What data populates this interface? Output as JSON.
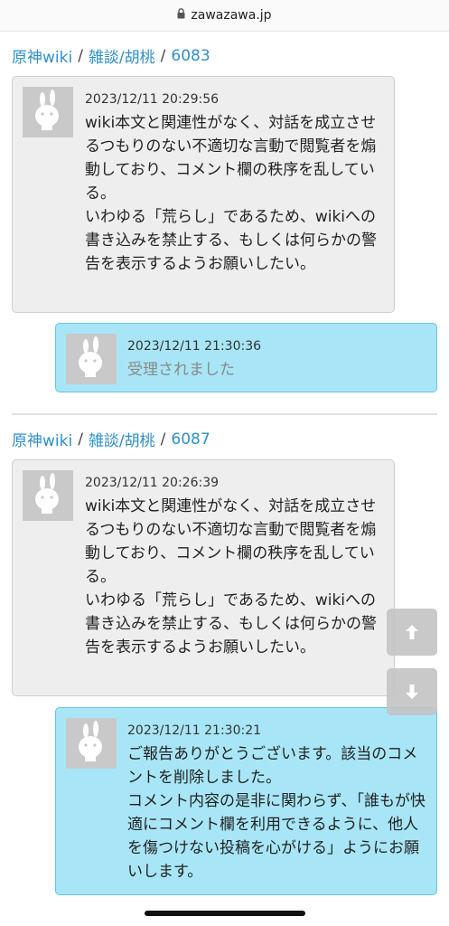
{
  "url": "zawazawa.jp",
  "sections": [
    {
      "crumb": {
        "site": "原神wiki",
        "topic": "雑談/胡桃",
        "post": "6083"
      },
      "report": {
        "time": "2023/12/11 20:29:56",
        "text": "wiki本文と関連性がなく、対話を成立させるつもりのない不適切な言動で閲覧者を煽動しており、コメント欄の秩序を乱している。\nいわゆる「荒らし」であるため、wikiへの書き込みを禁止する、もしくは何らかの警告を表示するようお願いしたい。"
      },
      "reply": {
        "time": "2023/12/11 21:30:36",
        "text": "受理されました"
      }
    },
    {
      "crumb": {
        "site": "原神wiki",
        "topic": "雑談/胡桃",
        "post": "6087"
      },
      "report": {
        "time": "2023/12/11 20:26:39",
        "text": "wiki本文と関連性がなく、対話を成立させるつもりのない不適切な言動で閲覧者を煽動しており、コメント欄の秩序を乱している。\nいわゆる「荒らし」であるため、wikiへの書き込みを禁止する、もしくは何らかの警告を表示するようお願いしたい。"
      },
      "reply": {
        "time": "2023/12/11 21:30:21",
        "text": "ご報告ありがとうございます。該当のコメントを削除しました。\nコメント内容の是非に関わらず、「誰もが快適にコメント欄を利用できるように、他人を傷つけない投稿を心がける」ようにお願いします。"
      }
    }
  ],
  "icons": {
    "lock": "lock-icon",
    "avatar": "rabbit-avatar-icon",
    "scroll_up": "arrow-up-icon",
    "scroll_down": "arrow-down-icon"
  },
  "colors": {
    "link": "#2f8fc9",
    "report_bg": "#eeeeee",
    "reply_bg": "#a8e6f7"
  }
}
